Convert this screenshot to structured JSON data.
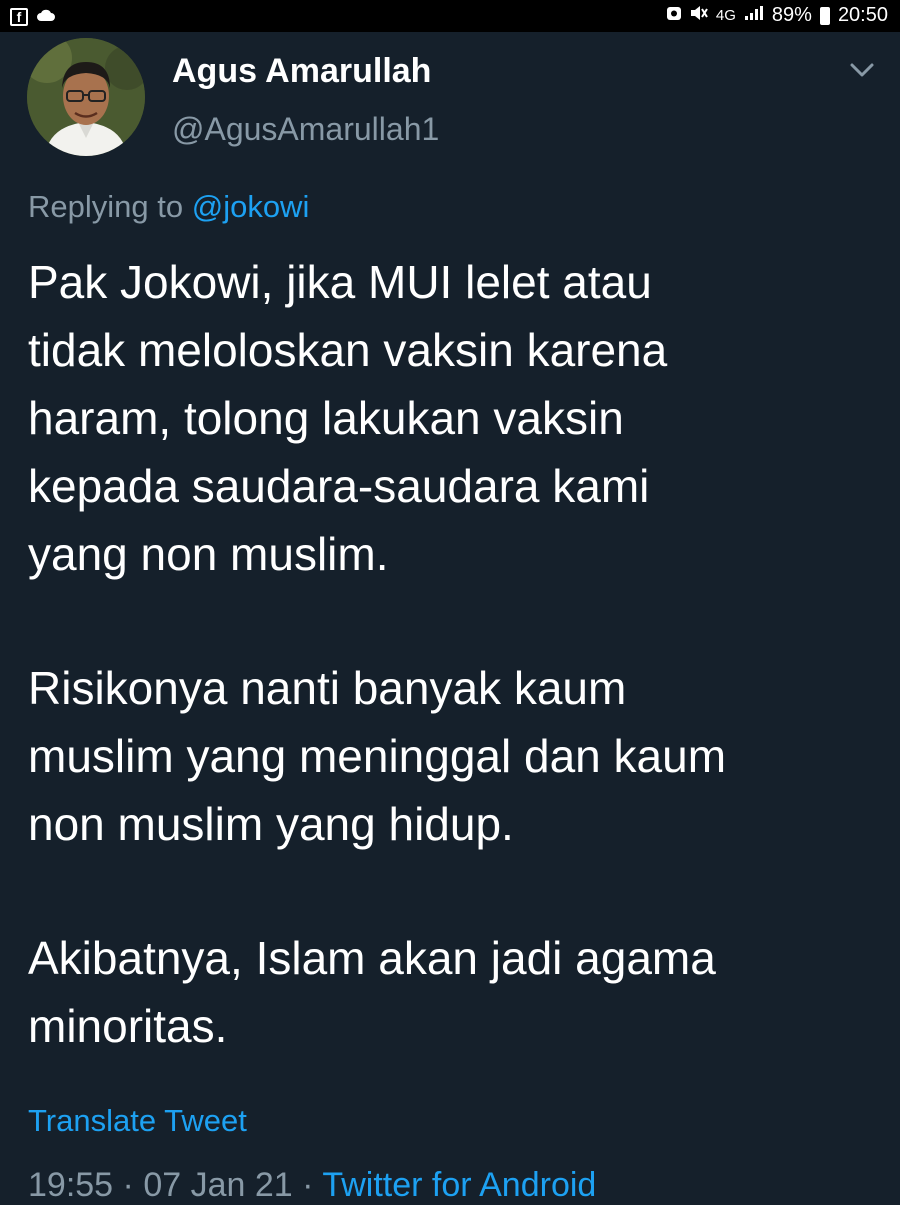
{
  "status_bar": {
    "left_icons": [
      "facebook-icon",
      "cloud-icon"
    ],
    "facebook_glyph": "f",
    "network_label": "4G",
    "battery": "89%",
    "time": "20:50"
  },
  "tweet": {
    "author_name": "Agus Amarullah",
    "author_handle": "@AgusAmarullah1",
    "replying_prefix": "Replying to",
    "replying_to": "@jokowi",
    "paragraphs": [
      "Pak Jokowi, jika MUI lelet atau\ntidak meloloskan vaksin karena\nharam, tolong lakukan vaksin\nkepada saudara-saudara kami\nyang non muslim.",
      "Risikonya nanti banyak kaum\nmuslim yang meninggal dan kaum\nnon muslim yang hidup.",
      "Akibatnya, Islam akan jadi agama\nminoritas."
    ],
    "translate_label": "Translate Tweet",
    "time": "19:55",
    "separator": "·",
    "date": "07 Jan 21",
    "source": "Twitter for Android"
  },
  "colors": {
    "background": "#15202b",
    "text": "#ffffff",
    "muted": "#8899a6",
    "accent": "#1da1f2"
  }
}
